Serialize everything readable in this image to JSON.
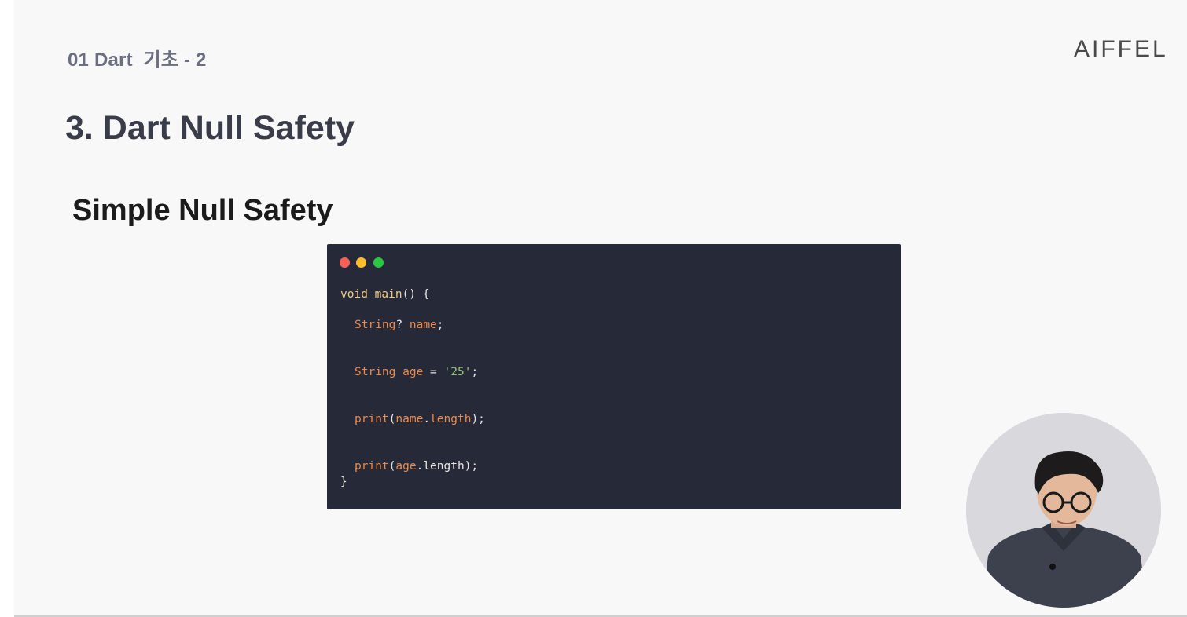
{
  "header": {
    "section_label": "01 Dart  기초 - 2",
    "brand": "AIFFEL"
  },
  "main": {
    "title": "3. Dart Null Safety",
    "subtitle": "Simple Null Safety"
  },
  "code": {
    "line1": {
      "kw": "void",
      "fn": "main",
      "rest": "() {"
    },
    "line2": {
      "type": "String",
      "q": "? ",
      "name": "name",
      "end": ";"
    },
    "line3": {
      "type": "String",
      "var": " age",
      "eq": " = ",
      "str": "'25'",
      "end": ";"
    },
    "line4": {
      "fn": "print",
      "open": "(",
      "obj": "name",
      "dot": ".",
      "prop": "length",
      "close": ");"
    },
    "line5": {
      "fn": "print",
      "open": "(",
      "obj": "age",
      "rest": ".length);"
    },
    "line6": "}"
  },
  "presenter": {
    "icon": "presenter-webcam"
  },
  "colors": {
    "code_bg": "#262a38",
    "keyword": "#f2c97d",
    "type": "#ec8a4a",
    "string": "#98c379",
    "title": "#3b3c4a",
    "section": "#6b6e80"
  }
}
